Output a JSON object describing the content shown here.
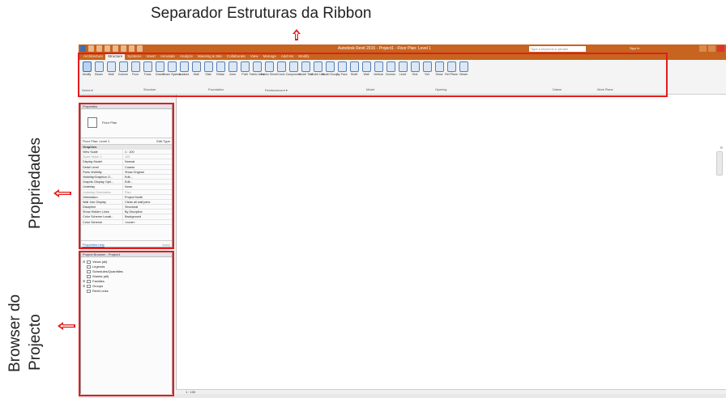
{
  "annotations": {
    "ribbon_label": "Separador Estruturas da Ribbon",
    "properties_label": "Propriedades",
    "browser_label_line1": "Browser do",
    "browser_label_line2": "Projecto",
    "highlight_color": "#e41c1c"
  },
  "app": {
    "title": "Autodesk Revit 2015 -    Project1 - Floor Plan: Level 1",
    "search_placeholder": "Type a keyword or phrase",
    "sign_in": "Sign In",
    "title_color": "#c7641f"
  },
  "ribbon": {
    "tabs": [
      "Architecture",
      "Structure",
      "Systems",
      "Insert",
      "Annotate",
      "Analyze",
      "Massing & Site",
      "Collaborate",
      "View",
      "Manage",
      "Add-Ins",
      "Modify"
    ],
    "active_tab": "Structure",
    "tools": [
      "Modify",
      "Beam",
      "Wall",
      "Column",
      "Floor",
      "Truss",
      "Brace",
      "Beam System",
      "Isolated",
      "Wall",
      "Slab",
      "Rebar",
      "Area",
      "Path",
      "Fabric Area",
      "Fabric Sheet",
      "Cover",
      "Component",
      "Model Text",
      "Model Line",
      "Model Group",
      "By Face",
      "Shaft",
      "Wall",
      "Vertical",
      "Dormer",
      "Level",
      "Grid",
      "Set",
      "Show",
      "Ref Plane",
      "Viewer"
    ],
    "groups": [
      "Select ▾",
      "Structure",
      "Foundation",
      "Reinforcement ▾",
      "Model",
      "Opening",
      "Datum",
      "Work Plane"
    ]
  },
  "properties": {
    "title": "Properties",
    "type_name": "Floor Plan",
    "selector": "Floor Plan: Level 1",
    "edit_type": "Edit Type",
    "group": "Graphics",
    "rows": [
      {
        "k": "View Scale",
        "v": "1 : 100"
      },
      {
        "k": "Scale Value   1:",
        "v": "100"
      },
      {
        "k": "Display Model",
        "v": "Normal"
      },
      {
        "k": "Detail Level",
        "v": "Coarse"
      },
      {
        "k": "Parts Visibility",
        "v": "Show Original"
      },
      {
        "k": "Visibility/Graphics O...",
        "v": "Edit..."
      },
      {
        "k": "Graphic Display Opti...",
        "v": "Edit..."
      },
      {
        "k": "Underlay",
        "v": "None"
      },
      {
        "k": "Underlay Orientation",
        "v": "Plan"
      },
      {
        "k": "Orientation",
        "v": "Project North"
      },
      {
        "k": "Wall Join Display",
        "v": "Clean all wall joins"
      },
      {
        "k": "Discipline",
        "v": "Structural"
      },
      {
        "k": "Show Hidden Lines",
        "v": "By Discipline"
      },
      {
        "k": "Color Scheme Locati...",
        "v": "Background"
      },
      {
        "k": "Color Scheme",
        "v": "<none>"
      }
    ],
    "help_link": "Properties help",
    "apply": "Apply"
  },
  "browser": {
    "title": "Project Browser - Project1",
    "items": [
      {
        "label": "Views (all)",
        "toggle": "⊞",
        "level": 1
      },
      {
        "label": "Legends",
        "toggle": "",
        "level": 1
      },
      {
        "label": "Schedules/Quantities",
        "toggle": "",
        "level": 1
      },
      {
        "label": "Sheets (all)",
        "toggle": "",
        "level": 1
      },
      {
        "label": "Families",
        "toggle": "⊞",
        "level": 1
      },
      {
        "label": "Groups",
        "toggle": "⊞",
        "level": 1
      },
      {
        "label": "Revit Links",
        "toggle": "",
        "level": 1
      }
    ]
  },
  "view_control": {
    "scale": "1 : 100"
  }
}
